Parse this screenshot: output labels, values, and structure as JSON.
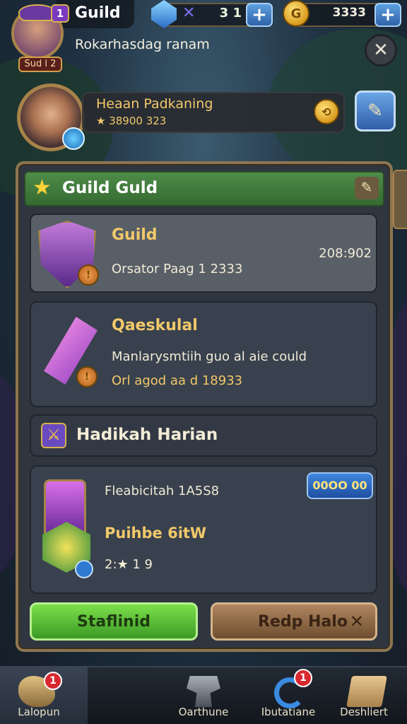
{
  "header": {
    "title": "Guild",
    "level_badge": "1",
    "player_level": "Sud l 2",
    "subtitle": "Rokarhasdag ranam",
    "gems_value": "3 1",
    "coins_value": "3333"
  },
  "profile": {
    "name": "Heaan Padkaning",
    "stats": "★ 38900 323"
  },
  "panel": {
    "title": "Guild Guld"
  },
  "cards": [
    {
      "title": "Guild",
      "line1": "Orsator Paag 1 2333",
      "value": "208:902"
    },
    {
      "title": "Qaeskulal",
      "line1": "Manlarysmtiih guo al aie could",
      "line2": "Orl agod aa d 18933"
    }
  ],
  "section": {
    "title": "Hadikah Harian"
  },
  "reward": {
    "line1": "Fleabicitah 1A5S8",
    "title": "Puihbe 6itW",
    "line2": "2:★ 1 9",
    "tag": "00OO 00"
  },
  "buttons": {
    "primary": "Staflinid",
    "secondary": "Redp Halo"
  },
  "nav": [
    {
      "label": "Lalopun",
      "badge": "1"
    },
    {
      "label": "Oarthune"
    },
    {
      "label": "Ibutatiane",
      "badge": "1"
    },
    {
      "label": "Deshliert"
    }
  ],
  "colors": {
    "accent_gold": "#f2c86a",
    "panel_header_green": "#3f7a3c",
    "primary_button": "#5cc23a",
    "secondary_button": "#8a6a4a"
  }
}
